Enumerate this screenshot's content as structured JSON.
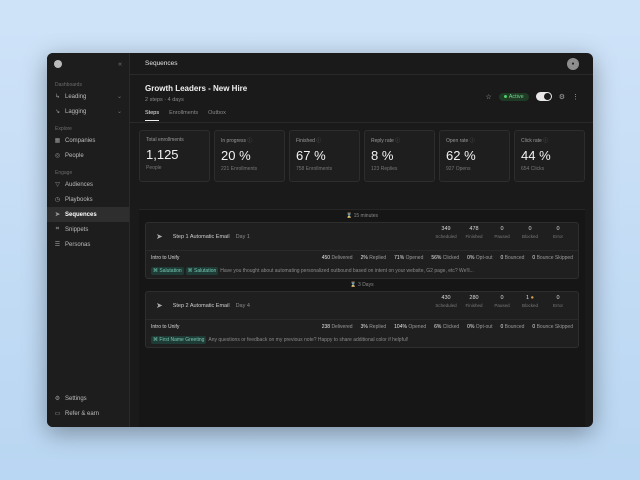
{
  "sidebar": {
    "sections": {
      "dashboards": "Dashboards",
      "explore": "Explore",
      "engage": "Engage"
    },
    "dashboard_items": [
      {
        "label": "Leading",
        "icon": "chart-icon"
      },
      {
        "label": "Lagging",
        "icon": "trend-icon"
      }
    ],
    "explore_items": [
      {
        "label": "Companies",
        "icon": "building-icon"
      },
      {
        "label": "People",
        "icon": "user-icon"
      }
    ],
    "engage_items": [
      {
        "label": "Audiences",
        "icon": "filter-icon"
      },
      {
        "label": "Playbooks",
        "icon": "book-icon"
      },
      {
        "label": "Sequences",
        "icon": "send-icon"
      },
      {
        "label": "Snippets",
        "icon": "snippet-icon"
      },
      {
        "label": "Personas",
        "icon": "list-icon"
      }
    ],
    "bottom_items": [
      {
        "label": "Settings",
        "icon": "gear-icon"
      },
      {
        "label": "Refer & earn",
        "icon": "gift-icon"
      }
    ]
  },
  "topbar": {
    "title": "Sequences"
  },
  "header": {
    "title": "Growth Leaders - New Hire",
    "subtitle": "2 steps · 4 days",
    "status": "Active"
  },
  "tabs": [
    "Steps",
    "Enrollments",
    "Outbox"
  ],
  "stats": [
    {
      "label": "Total enrollments",
      "info": "",
      "value": "1,125",
      "sub": "People"
    },
    {
      "label": "In progress",
      "info": "ⓘ",
      "value": "20 %",
      "sub": "221 Enrollments"
    },
    {
      "label": "Finished",
      "info": "ⓘ",
      "value": "67 %",
      "sub": "758 Enrollments"
    },
    {
      "label": "Reply rate",
      "info": "ⓘ",
      "value": "8 %",
      "sub": "123 Replies"
    },
    {
      "label": "Open rate",
      "info": "ⓘ",
      "value": "62 %",
      "sub": "927 Opens"
    },
    {
      "label": "Click rate",
      "info": "ⓘ",
      "value": "44 %",
      "sub": "654 Clicks"
    }
  ],
  "flow": {
    "delay1": "15 minutes",
    "delay2": "3 Days",
    "metric_labels": [
      "Scheduled",
      "Finished",
      "Paused",
      "Blocked",
      "Error"
    ],
    "steps": [
      {
        "title": "Step 1 Automatic Email",
        "day": "Day 1",
        "metrics": [
          "349",
          "478",
          "0",
          "0",
          "0"
        ],
        "variant": "Intro to Unify",
        "stats": [
          {
            "value": "450",
            "label": "Delivered"
          },
          {
            "value": "2%",
            "label": "Replied"
          },
          {
            "value": "71%",
            "label": "Opened"
          },
          {
            "value": "56%",
            "label": "Clicked"
          },
          {
            "value": "0%",
            "label": "Opt-out"
          },
          {
            "value": "0",
            "label": "Bounced"
          },
          {
            "value": "0",
            "label": "Bounce Skipped"
          }
        ],
        "chips": [
          "Salutation",
          "Salutation"
        ],
        "preview": "Have you thought about automating personalized outbound based on intent on your website, G2 page, etc? We'll..."
      },
      {
        "title": "Step 2 Automatic Email",
        "day": "Day 4",
        "metrics": [
          "430",
          "280",
          "0",
          "1",
          "0"
        ],
        "variant": "Intro to Unify",
        "stats": [
          {
            "value": "238",
            "label": "Delivered"
          },
          {
            "value": "3%",
            "label": "Replied"
          },
          {
            "value": "104%",
            "label": "Opened"
          },
          {
            "value": "6%",
            "label": "Clicked"
          },
          {
            "value": "0%",
            "label": "Opt-out"
          },
          {
            "value": "0",
            "label": "Bounced"
          },
          {
            "value": "0",
            "label": "Bounce Skipped"
          }
        ],
        "chips": [
          "First Name Greeting"
        ],
        "preview": "Any questions or feedback on my previous note? Happy to share additional color if helpful!"
      }
    ]
  },
  "colors": {
    "accent_green": "#4dd36d",
    "chip_bg": "#1f3b35",
    "chip_fg": "#76c9b4"
  }
}
